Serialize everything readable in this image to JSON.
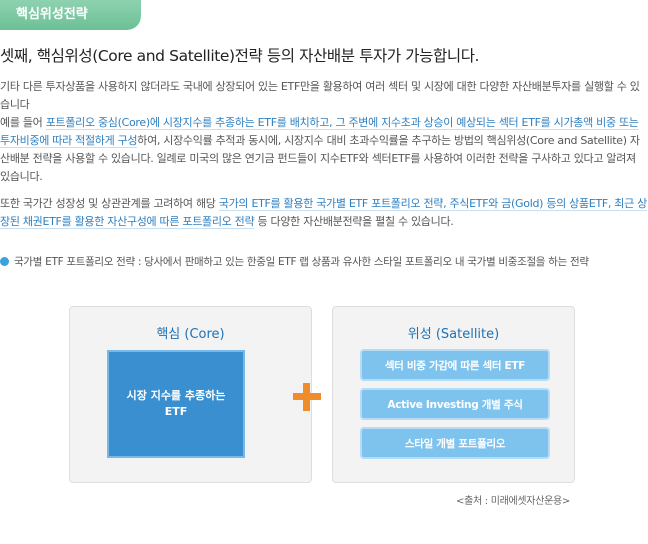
{
  "tag": {
    "label": "핵심위성전략"
  },
  "heading": "셋째, 핵심위성(Core and Satellite)전략 등의 자산배분 투자가 가능합니다.",
  "paragraph1": {
    "t1": "기타 다른 투자상품을 사용하지 않더라도 국내에 상장되어 있는 ETF만을 활용하여 여러 섹터 및 시장에 대한 다양한 자산배분투자를 실행할 수 있습니다",
    "t2": "예를 들어 ",
    "h1": "포트폴리오 중심(Core)에 시장지수를 추종하는 ETF를 배치하고, 그 주변에 지수초과 상승이 예상되는 섹터 ETF를 시가총액 비중 또는 투자비중에 따라 적절하게 구성",
    "t3": "하여, 시장수익률 추적과 동시에, 시장지수 대비 초과수익률을 추구하는 방법의 핵심위성(Core and Satellite) 자산배분 전략을 사용할 수 있습니다. 일례로 미국의 많은 연기금 펀드들이 지수ETF와 섹터ETF를 사용하여 이러한 전략을 구사하고 있다고 알려져 있습니다."
  },
  "paragraph2": {
    "t1": "또한 국가간 성장성 및 상관관계를 고려하여 해당 ",
    "h1": "국가의 ETF를 활용한 국가별 ETF 포트폴리오 전략, 주식ETF와 금(Gold) 등의 상품ETF, 최근 상장된 채권ETF를 활용한 자산구성에 따른 포트폴리오 전략",
    "t2": " 등 다양한 자산배분전략을 펼칠 수 있습니다."
  },
  "bullet": "국가별 ETF 포트폴리오 전략 : 당사에서 판매하고 있는 한중일 ETF 랩 상품과 유사한 스타일 포트폴리오 내 국가별 비중조절을 하는 전략",
  "diagram": {
    "core": {
      "title": "핵심 (Core)",
      "box": "시장 지수를 추종하는 ETF"
    },
    "satellite": {
      "title": "위성 (Satellite)",
      "items": [
        "섹터 비중 가감에 따른 섹터 ETF",
        "Active Investing 개별 주식",
        "스타일 개별 포트폴리오"
      ]
    },
    "plus_color": "#f08c2a"
  },
  "source": "<출처 : 미래에셋자산운용>"
}
